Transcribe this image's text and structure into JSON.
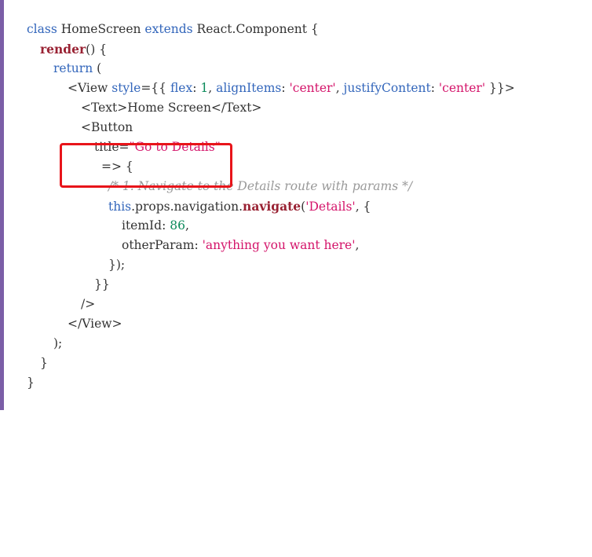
{
  "colors": {
    "keyword": "#3366bb",
    "method": "#992233",
    "string": "#d4146a",
    "number": "#0a8a5a",
    "comment": "#999999",
    "highlight_box": "#e8141a",
    "left_bar": "#7b5ea7"
  },
  "code": {
    "l1": {
      "kw": "class",
      "a": " HomeScreen ",
      "kw2": "extends",
      "b": " React.Component {"
    },
    "l2": {
      "fn": "render",
      "a": "() {"
    },
    "l3": {
      "kw": "return",
      "a": " ("
    },
    "l4": {
      "a": "<View ",
      "kw": "style",
      "b": "={{ ",
      "kw2": "flex",
      "c": ": ",
      "num": "1",
      "d": ", ",
      "kw3": "alignItems",
      "e": ": ",
      "str": "'center'",
      "f": ", ",
      "kw4": "justifyContent",
      "g": ": ",
      "str2": "'center'",
      "h": " }}>"
    },
    "l5": {
      "a": "<Text>Home Screen</Text>"
    },
    "l6": {
      "a": "<Button"
    },
    "l7": {
      "a": "title=",
      "str": "\"Go to Details\""
    },
    "l8": {
      "a": "=> {"
    },
    "l9": {
      "cm": "/* 1. Navigate to the Details route with params */"
    },
    "l10": {
      "kw": "this",
      "a": ".props.navigation.",
      "fn": "navigate",
      "b": "(",
      "str": "'Details'",
      "c": ", {"
    },
    "l11": {
      "a": "itemId: ",
      "num": "86",
      "b": ","
    },
    "l12": {
      "a": "otherParam: ",
      "str": "'anything you want here'",
      "b": ","
    },
    "l13": {
      "a": "});"
    },
    "l14": {
      "a": "}}"
    },
    "l15": {
      "a": "/>"
    },
    "l16": {
      "a": "</View>"
    },
    "l17": {
      "a": ");"
    },
    "l18": {
      "a": "}"
    },
    "l19": {
      "a": "}"
    }
  }
}
